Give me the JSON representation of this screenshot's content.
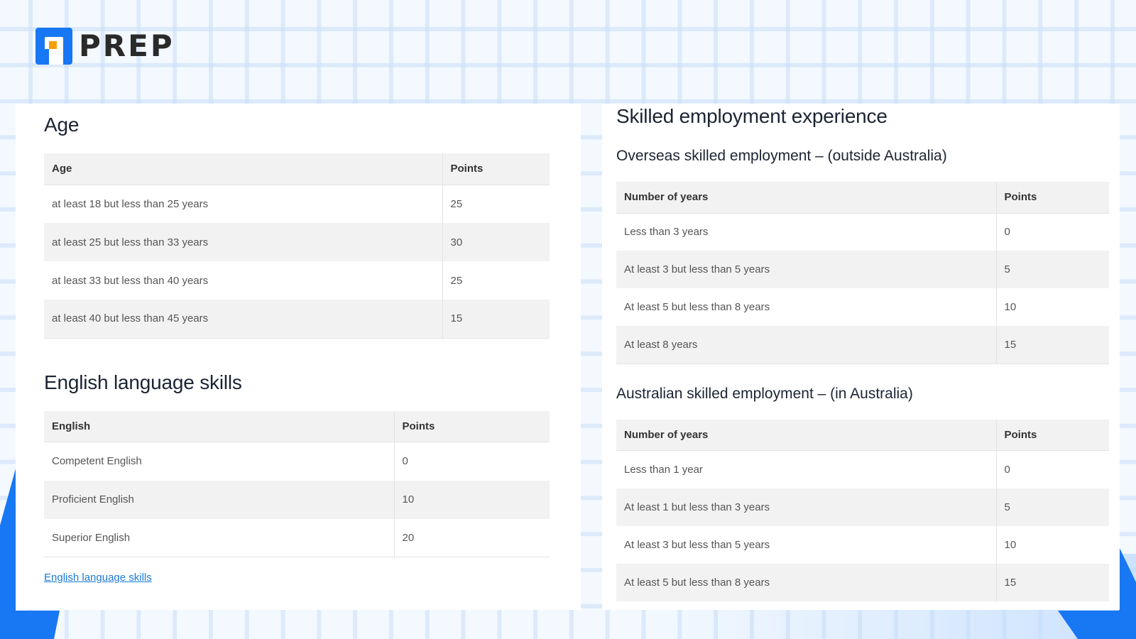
{
  "brand": {
    "name": "PREP"
  },
  "left": {
    "age": {
      "title": "Age",
      "headers": [
        "Age",
        "Points"
      ],
      "rows": [
        [
          "at least 18 but less than 25 years",
          "25"
        ],
        [
          "at least  25 but less than 33 years",
          "30"
        ],
        [
          "at least  33 but less than 40 years",
          "25"
        ],
        [
          "at least  40 but less than 45 years",
          "15"
        ]
      ]
    },
    "english": {
      "title": "English language skills",
      "headers": [
        "English",
        "Points"
      ],
      "rows": [
        [
          "Competent English",
          "0"
        ],
        [
          "Proficient English",
          "10"
        ],
        [
          "Superior English",
          "20"
        ]
      ],
      "link": "English language skills"
    }
  },
  "right": {
    "title": "Skilled employment experience",
    "overseas": {
      "title": "Overseas skilled employment – (outside Australia)",
      "headers": [
        "Number of years",
        "Points"
      ],
      "rows": [
        [
          "Less than 3 years",
          "0"
        ],
        [
          "At least 3 but less than 5 years",
          "5"
        ],
        [
          "At least 5 but less than 8 years",
          "10"
        ],
        [
          "At least 8 years",
          "15"
        ]
      ]
    },
    "australian": {
      "title": "Australian skilled employment – (in Australia)",
      "headers": [
        "Number of years",
        "Points"
      ],
      "rows": [
        [
          "Less than 1 year",
          "0"
        ],
        [
          "At least 1 but less than 3 years",
          "5"
        ],
        [
          "At least 3 but less than 5 years",
          "10"
        ],
        [
          "At least 5 but less than 8 years",
          "15"
        ]
      ]
    }
  }
}
